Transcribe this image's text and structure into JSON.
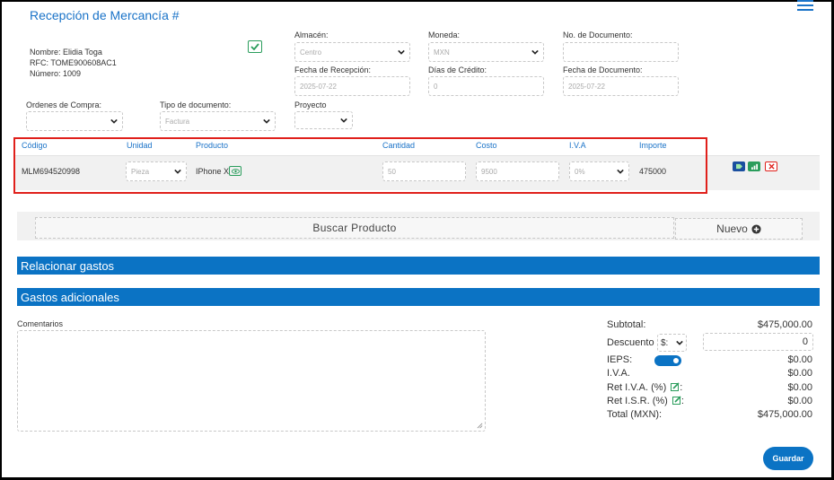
{
  "header": {
    "title": "Recepción de Mercancía #"
  },
  "supplier": {
    "name": "Nombre: Elidia Toga",
    "rfc": "RFC: TOME900608AC1",
    "number": "Número: 1009"
  },
  "form": {
    "almacen_label": "Almacén:",
    "almacen_value": "Centro",
    "moneda_label": "Moneda:",
    "moneda_value": "MXN",
    "no_doc_label": "No. de Documento:",
    "no_doc_value": "",
    "fecha_recepcion_label": "Fecha de Recepción:",
    "fecha_recepcion_value": "2025-07-22",
    "dias_credito_label": "Días de Crédito:",
    "dias_credito_value": "0",
    "fecha_doc_label": "Fecha de Documento:",
    "fecha_doc_value": "2025-07-22",
    "ordenes_label": "Ordenes de Compra:",
    "ordenes_value": "",
    "tipo_doc_label": "Tipo de documento:",
    "tipo_doc_value": "Factura",
    "proyecto_label": "Proyecto",
    "proyecto_value": ""
  },
  "table": {
    "headers": [
      "Código",
      "Unidad",
      "Producto",
      "Cantidad",
      "Costo",
      "I.V.A",
      "Importe"
    ],
    "row": {
      "codigo": "MLM694520998",
      "unidad": "Pieza",
      "producto": "IPhone X",
      "cantidad": "50",
      "costo": "9500",
      "iva": "0%",
      "importe": "475000"
    }
  },
  "actions": {
    "buscar": "Buscar Producto",
    "nuevo": "Nuevo",
    "guardar": "Guardar"
  },
  "sections": {
    "relacionar": "Relacionar gastos",
    "gastos": "Gastos adicionales",
    "comentarios": "Comentarios"
  },
  "totals": {
    "subtotal_label": "Subtotal:",
    "subtotal_value": "$475,000.00",
    "descuento_label": "Descuento",
    "descuento_select": "$:",
    "descuento_value": "0",
    "ieps_label": "IEPS:",
    "ieps_value": "$0.00",
    "iva_label": "I.V.A.",
    "iva_value": "$0.00",
    "ret_iva_label": "Ret I.V.A. (%)",
    "ret_iva_value": "$0.00",
    "ret_isr_label": "Ret I.S.R. (%)",
    "ret_isr_value": "$0.00",
    "colon": ":",
    "total_label": "Total (MXN):",
    "total_value": "$475,000.00"
  },
  "colors": {
    "accent": "#0b73c4",
    "link": "#1a73c8",
    "success": "#2a9d5c",
    "danger": "#e0201b"
  },
  "icons": [
    "menu-icon",
    "check-icon",
    "eye-icon",
    "tag-icon",
    "chart-icon",
    "close-icon",
    "plus-circle-icon",
    "edit-icon",
    "chevron-down-icon"
  ]
}
